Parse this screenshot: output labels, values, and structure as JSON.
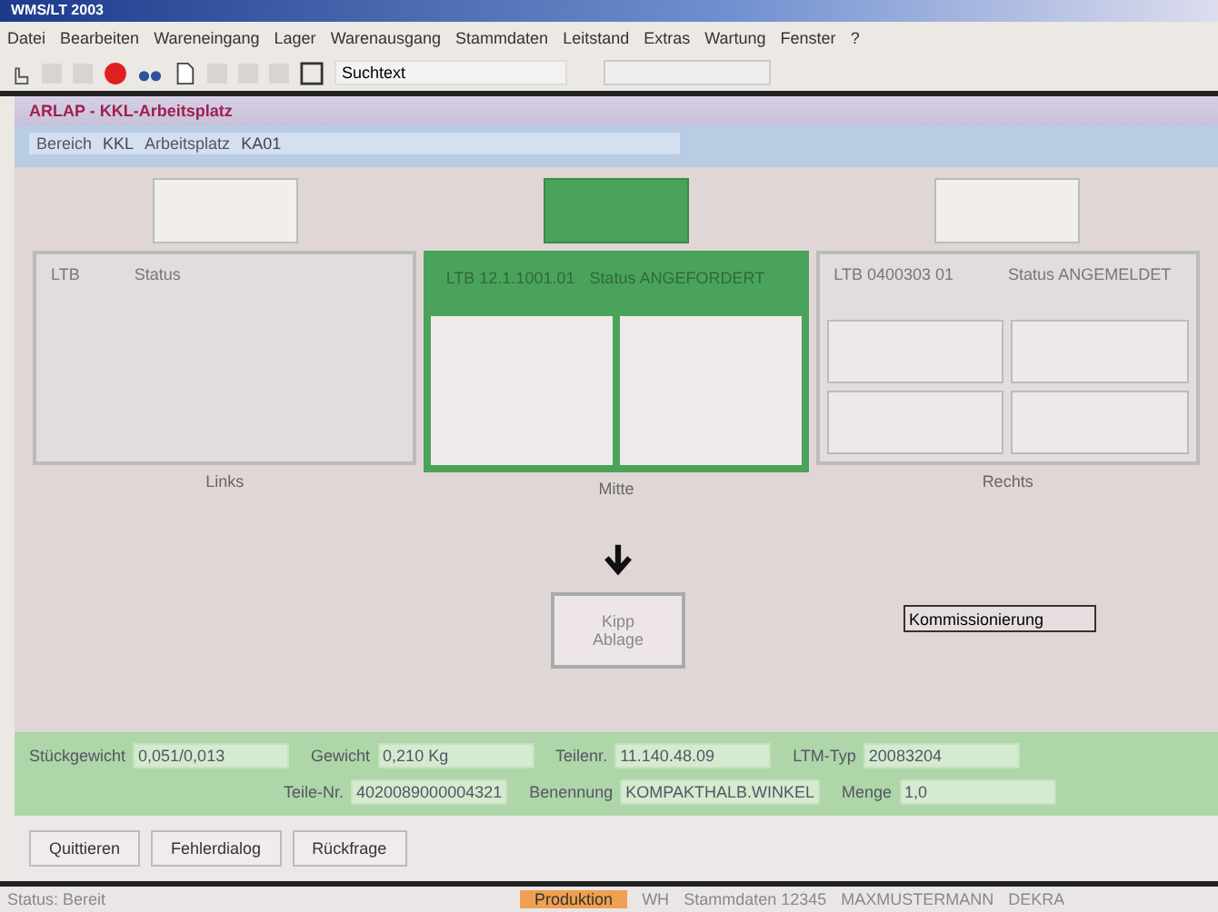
{
  "app_title": "WMS/LT 2003",
  "menu": [
    "Datei",
    "Bearbeiten",
    "Wareneingang",
    "Lager",
    "Warenausgang",
    "Stammdaten",
    "Leitstand",
    "Extras",
    "Wartung",
    "Fenster",
    "?"
  ],
  "toolbar": {
    "search": {
      "value": "Suchtext"
    }
  },
  "window": {
    "title": "ARLAP - KKL-Arbeitsplatz",
    "header_fields": [
      {
        "label": "Bereich",
        "value": "KKL"
      },
      {
        "label": "Arbeitsplatz",
        "value": "KA01"
      }
    ]
  },
  "slots": [
    {
      "label": "Links",
      "selected": false,
      "kind": "single",
      "ltb": "LTB",
      "status": "Status"
    },
    {
      "label": "Mitte",
      "selected": true,
      "kind": "halves",
      "ltb": "LTB 12.1.1001.01",
      "status": "Status ANGEFORDERT"
    },
    {
      "label": "Rechts",
      "selected": false,
      "kind": "quarters",
      "ltb": "LTB 0400303 01",
      "status": "Status ANGEMELDET"
    }
  ],
  "station": {
    "lines": [
      "Kipp",
      "Ablage"
    ]
  },
  "mode_field": {
    "value": "Kommissionierung"
  },
  "info_rows": [
    [
      {
        "label": "Stückgewicht",
        "value": "0,051/0,013"
      },
      {
        "label": "Gewicht",
        "value": "0,210 Kg"
      },
      {
        "label": "Teilenr.",
        "value": "11.140.48.09"
      },
      {
        "label": "LTM-Typ",
        "value": "20083204"
      }
    ],
    [
      {
        "label": "Teile-Nr.",
        "value": "4020089000004321"
      },
      {
        "label": "Benennung",
        "value": "KOMPAKTHALB.WINKEL"
      },
      {
        "label": "Menge",
        "value": "1,0"
      }
    ]
  ],
  "buttons": [
    "Quittieren",
    "Fehlerdialog",
    "Rückfrage"
  ],
  "status_bar": [
    {
      "text": "Status: Bereit",
      "highlighted": false
    },
    {
      "text": "Produktion",
      "highlighted": true
    },
    {
      "text": "WH",
      "highlighted": false
    },
    {
      "text": "Stammdaten 12345",
      "highlighted": false
    },
    {
      "text": "MAXMUSTERMANN",
      "highlighted": false
    },
    {
      "text": "DEKRA",
      "highlighted": false
    }
  ]
}
